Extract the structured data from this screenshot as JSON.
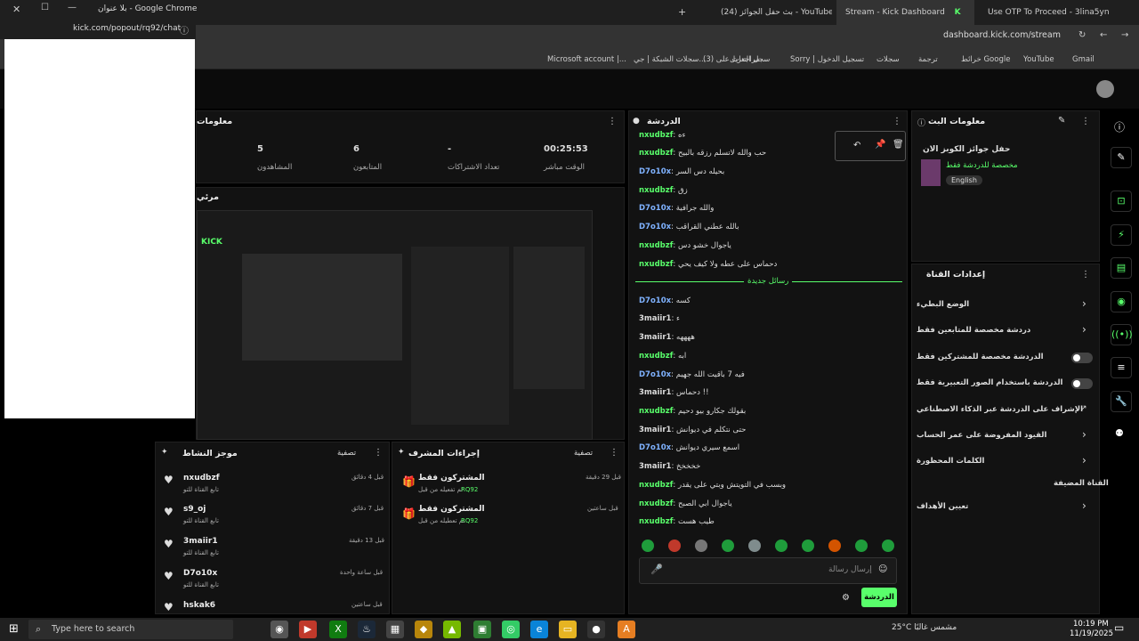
{
  "popup": {
    "title": "بلا عنوان - Google Chrome",
    "url": "kick.com/popout/rq92/chat"
  },
  "tabs": [
    {
      "label": "(24) بث حفل الجوائز - YouTube"
    },
    {
      "label": "Stream - Kick Dashboard"
    },
    {
      "label": "Use OTP To Proceed - 3lina5yn"
    }
  ],
  "address": "dashboard.kick.com/stream",
  "bookmarks": [
    "Microsoft account |...",
    "سجلات الشبكة | جي...",
    "(3) مراجعات على...",
    "سجل التنزيل",
    "Sorry | تسجيل الدخول",
    "سجلات",
    "ترجمة",
    "خرائط Google",
    "YouTube",
    "Gmail"
  ],
  "stats": [
    {
      "value": "00:25:53",
      "label": "الوقت مباشر"
    },
    {
      "value": "-",
      "label": "تعداد الاشتراكات"
    },
    {
      "value": "6",
      "label": "المتابعون"
    },
    {
      "value": "5",
      "label": "المشاهدون"
    }
  ],
  "panels": {
    "stats_header": "معلومات",
    "preview_header": "مرئي",
    "chat_header": "الدردشة",
    "stream_info_header": "معلومات البث",
    "settings_header": "إعدادات القناة",
    "activity_header": "موجز النشاط",
    "activity_filter": "تصفية",
    "subs_header": "إجراءات المشرف",
    "subs_filter": "تصفية"
  },
  "chat": {
    "new_messages": "رسائل جديدة",
    "messages": [
      {
        "user": "nxudbzf",
        "text": "ءه",
        "color": "g"
      },
      {
        "user": "nxudbzf",
        "text": "حب والله لاتسلم رزقه بالبيح",
        "color": "g"
      },
      {
        "user": "D7o10x",
        "text": "بحيله دس السر",
        "color": "b"
      },
      {
        "user": "nxudbzf",
        "text": "زق",
        "color": "g"
      },
      {
        "user": "D7o10x",
        "text": "والله جرافية",
        "color": "b"
      },
      {
        "user": "D7o10x",
        "text": "بالله عطني القراقب",
        "color": "b"
      },
      {
        "user": "nxudbzf",
        "text": "ياجوال خشو دس",
        "color": "g"
      },
      {
        "user": "nxudbzf",
        "text": "دحماس على عطه ولا كيف يحي",
        "color": "g"
      },
      {
        "user": "D7o10x",
        "text": "كسه",
        "color": "b"
      },
      {
        "user": "3maiir1",
        "text": "ء",
        "color": "w"
      },
      {
        "user": "3maiir1",
        "text": "ههههه",
        "color": "w"
      },
      {
        "user": "nxudbzf",
        "text": "ابه",
        "color": "g"
      },
      {
        "user": "D7o10x",
        "text": "فيه 7 باقيت الله جهيم",
        "color": "b"
      },
      {
        "user": "3maiir1",
        "text": "دحماس !!",
        "color": "w"
      },
      {
        "user": "nxudbzf",
        "text": "بقولك جكارو بيو دحيم",
        "color": "g"
      },
      {
        "user": "3maiir1",
        "text": "حتى نتكلم في ديوانش",
        "color": "w"
      },
      {
        "user": "D7o10x",
        "text": "اسمع سيري ديوانش",
        "color": "b"
      },
      {
        "user": "3maiir1",
        "text": "خخخخخ",
        "color": "w"
      },
      {
        "user": "nxudbzf",
        "text": "وبسب في التويتش وبتي على يقدر",
        "color": "g"
      },
      {
        "user": "nxudbzf",
        "text": "ياجوال ابي الصبح",
        "color": "g"
      },
      {
        "user": "nxudbzf",
        "text": "طيب هست",
        "color": "g"
      }
    ],
    "input_placeholder": "إرسال رسالة",
    "send_label": "الدردشة"
  },
  "stream_info": {
    "title": "حفل جوائز الكوبز الان",
    "category": "مخصصة للدردشة فقط",
    "language": "English"
  },
  "settings": [
    {
      "label": "الوضع البطيء",
      "control": "chevron"
    },
    {
      "label": "دردشة مخصصة للمتابعين فقط",
      "control": "chevron"
    },
    {
      "label": "الدردشة مخصصة للمشتركين فقط",
      "control": "toggle"
    },
    {
      "label": "الدردشة باستخدام الصور التعبيرية فقط",
      "control": "toggle"
    },
    {
      "label": "الإشراف على الدردشة عبر الذكاء الاصطناعي",
      "control": "external"
    },
    {
      "label": "القيود المفروضة على عمر الحساب",
      "control": "chevron"
    },
    {
      "label": "الكلمات المحظورة",
      "control": "chevron"
    },
    {
      "label": "القناة المضيفة",
      "control": "none"
    },
    {
      "label": "تعيين الأهداف",
      "control": "chevron"
    }
  ],
  "activity": [
    {
      "user": "nxudbzf",
      "sub": "تابع القناة للتو",
      "time": "قبل 4 دقائق"
    },
    {
      "user": "s9_oj",
      "sub": "تابع القناة للتو",
      "time": "قبل 7 دقائق"
    },
    {
      "user": "3maiir1",
      "sub": "تابع القناة للتو",
      "time": "قبل 13 دقيقة"
    },
    {
      "user": "D7o10x",
      "sub": "تابع القناة للتو",
      "time": "قبل ساعة واحدة"
    },
    {
      "user": "hskak6",
      "sub": "",
      "time": "قبل ساعتين"
    }
  ],
  "subs": [
    {
      "title": "المشتركون فقط",
      "sub": "تم تفعيله من قبل",
      "by": "RQ92",
      "time": "قبل 29 دقيقة"
    },
    {
      "title": "المشتركون فقط",
      "sub": "تم تعطيله من قبل",
      "by": "RQ92",
      "time": "قبل ساعتين"
    }
  ],
  "taskbar": {
    "search_placeholder": "Type here to search",
    "weather": "25°C مشمس غالبًا",
    "time": "10:19 PM",
    "date": "11/19/2025"
  },
  "colors": {
    "accent": "#59ff6b",
    "link": "#7fb2ff"
  }
}
